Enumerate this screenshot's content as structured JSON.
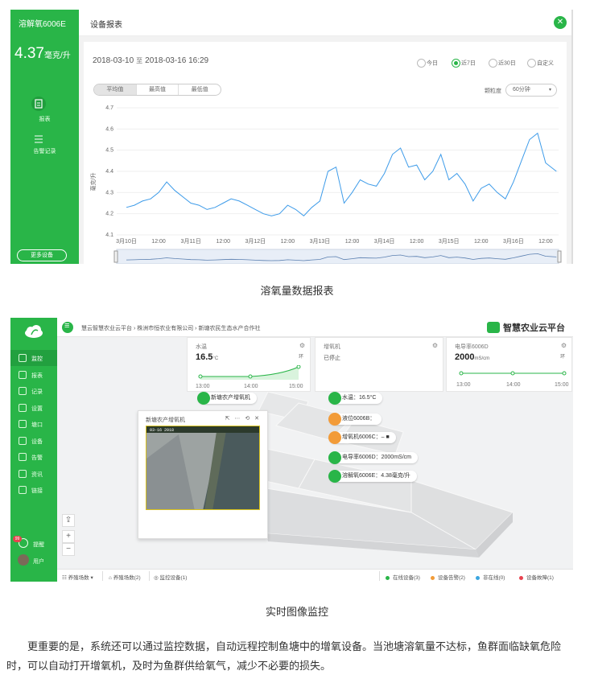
{
  "report": {
    "sidebar": {
      "device_name": "溶解氧6006E",
      "value": "4.37",
      "unit": "毫克/升",
      "nav": [
        {
          "label": "报表",
          "icon": "report-icon"
        },
        {
          "label": "告警记录",
          "icon": "list-icon"
        }
      ],
      "more_button": "更多设备"
    },
    "header": {
      "title": "设备报表",
      "close_icon": "close-icon"
    },
    "date_from": "2018-03-10",
    "date_sep": "至",
    "date_to": "2018-03-16 16:29",
    "ranges": [
      "今日",
      "近7日",
      "近30日",
      "自定义"
    ],
    "range_selected": 1,
    "stat_tabs": [
      "平均值",
      "最高值",
      "最低值"
    ],
    "stat_selected": 0,
    "granularity_label": "颗粒度",
    "granularity_value": "60分钟",
    "chart_data": {
      "type": "line",
      "ylabel": "毫克/升",
      "ylim": [
        4.1,
        4.7
      ],
      "yticks": [
        "4.1",
        "4.2",
        "4.3",
        "4.4",
        "4.5",
        "4.6",
        "4.7"
      ],
      "xticks": [
        "3月10日",
        "12:00",
        "3月11日",
        "12:00",
        "3月12日",
        "12:00",
        "3月13日",
        "12:00",
        "3月14日",
        "12:00",
        "3月15日",
        "12:00",
        "3月16日",
        "12:00"
      ],
      "x_hours_from_start": [
        0,
        3,
        6,
        9,
        12,
        15,
        18,
        21,
        24,
        27,
        30,
        33,
        36,
        39,
        42,
        45,
        48,
        51,
        54,
        57,
        60,
        63,
        66,
        69,
        72,
        75,
        78,
        81,
        84,
        87,
        90,
        93,
        96,
        99,
        102,
        105,
        108,
        111,
        114,
        117,
        120,
        123,
        126,
        129,
        132,
        135,
        138,
        141,
        144,
        147,
        150,
        153,
        156,
        160
      ],
      "values": [
        4.23,
        4.24,
        4.26,
        4.27,
        4.3,
        4.35,
        4.31,
        4.28,
        4.25,
        4.24,
        4.22,
        4.23,
        4.25,
        4.27,
        4.26,
        4.24,
        4.22,
        4.2,
        4.19,
        4.2,
        4.24,
        4.22,
        4.19,
        4.23,
        4.26,
        4.4,
        4.42,
        4.25,
        4.3,
        4.36,
        4.34,
        4.33,
        4.39,
        4.48,
        4.51,
        4.42,
        4.43,
        4.36,
        4.4,
        4.48,
        4.36,
        4.39,
        4.34,
        4.26,
        4.32,
        4.34,
        4.3,
        4.27,
        4.35,
        4.45,
        4.55,
        4.58,
        4.44,
        4.4
      ]
    }
  },
  "caption1": "溶氧量数据报表",
  "monitor": {
    "sidebar": {
      "logo_icon": "cloud-leaf-logo-icon",
      "items": [
        {
          "label": "监控",
          "active": true
        },
        {
          "label": "报表",
          "active": false
        },
        {
          "label": "记录",
          "active": false
        },
        {
          "label": "设置",
          "active": false
        },
        {
          "label": "塘口",
          "active": false
        },
        {
          "label": "设备",
          "active": false
        },
        {
          "label": "告警",
          "active": false
        },
        {
          "label": "资讯",
          "active": false
        },
        {
          "label": "链接",
          "active": false
        }
      ],
      "notify_label": "提醒",
      "notify_count": "99",
      "user_label": "用户"
    },
    "breadcrumb": "慧云智慧农业云平台 › 株洲市恒农业有限公司 › 新塘农民生态水产合作社",
    "platform_name": "智慧农业云平台",
    "cards": [
      {
        "title": "水温",
        "value": "16.5",
        "unit": "°C",
        "btn": "环",
        "xticks": [
          "13:00",
          "14:00",
          "15:00"
        ]
      },
      {
        "title": "增氧机",
        "value": "",
        "unit": "",
        "btn": "",
        "status": "已停止",
        "xticks": []
      },
      {
        "title": "电导率6006D",
        "value": "2000",
        "unit": "mS/cm",
        "btn": "环",
        "xticks": [
          "13:00",
          "14:00",
          "15:00"
        ]
      }
    ],
    "tags": [
      {
        "text": "新塘农产增氧机",
        "color": "#29b548"
      },
      {
        "text": "水温：16.5°C",
        "color": "#29b548"
      },
      {
        "text": "液位6006B：",
        "color": "#f29b38"
      },
      {
        "text": "增氧机6006C：– ■",
        "color": "#f29b38"
      },
      {
        "text": "电导率6006D：2000mS/cm",
        "color": "#29b548"
      },
      {
        "text": "溶解氧6006E：4.38毫克/升",
        "color": "#29b548"
      }
    ],
    "camera": {
      "title": "新塘农产增氧机",
      "controls": "⇱ ⋯ ⟲ ✕",
      "timestamp": "03-16 2018 ",
      "camera_icon": "camera-icon"
    },
    "bottom": {
      "layers": "养殖场数",
      "items": [
        "养殖场数(2)",
        "监控设备(1)"
      ],
      "status": [
        {
          "label": "在线设备(3)",
          "color": "#29b548"
        },
        {
          "label": "设备告警(2)",
          "color": "#f29b38"
        },
        {
          "label": "非在线(0)",
          "color": "#3aa6e0"
        },
        {
          "label": "设备故障(1)",
          "color": "#e8434f"
        }
      ]
    }
  },
  "caption2": "实时图像监控",
  "paragraph": "更重要的是，系统还可以通过监控数据，自动远程控制鱼塘中的增氧设备。当池塘溶氧量不达标，鱼群面临缺氧危险时，可以自动打开增氧机，及时为鱼群供给氧气，减少不必要的损失。"
}
